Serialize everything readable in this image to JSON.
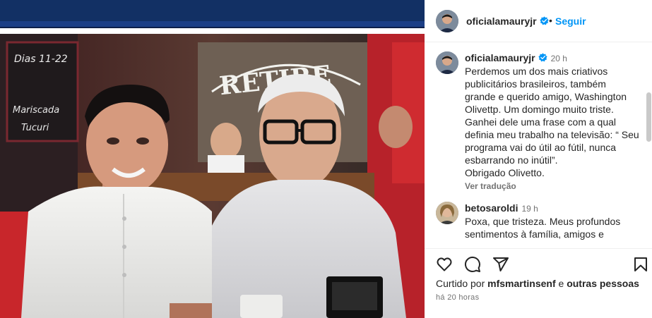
{
  "post": {
    "author": "oficialamauryjr",
    "follow_label": "Seguir",
    "separator": "•"
  },
  "caption": {
    "author": "oficialamauryjr",
    "time": "20 h",
    "text": "Perdemos um dos mais criativos\npublicitários brasileiros, também\ngrande e querido amigo, Washington\nOlivettp. Um domingo muito triste.\nGanhei dele uma frase com a qual\ndefinia meu trabalho na televisão: “ Seu\nprograma vai do útil ao fútil, nunca\nesbarrando no inútil”.\nObrigado Olivetto.",
    "translate_label": "Ver tradução"
  },
  "comment": {
    "author": "betosaroldi",
    "time": "19 h",
    "text": "Poxa, que tristeza. Meus profundos\nsentimentos à família, amigos e"
  },
  "likes": {
    "prefix": "Curtido por",
    "user": "mfsmartinsenf",
    "connector": "e",
    "others": "outras pessoas"
  },
  "posted_ago": "há 20 horas",
  "photo": {
    "sign_text": "RETIRE",
    "icons": [
      "photo",
      "heart-icon",
      "comment-icon",
      "share-icon",
      "save-icon",
      "verified-badge-icon"
    ]
  },
  "colors": {
    "link_blue": "#0095f6",
    "verified_blue": "#0095f6",
    "muted": "#737373"
  }
}
